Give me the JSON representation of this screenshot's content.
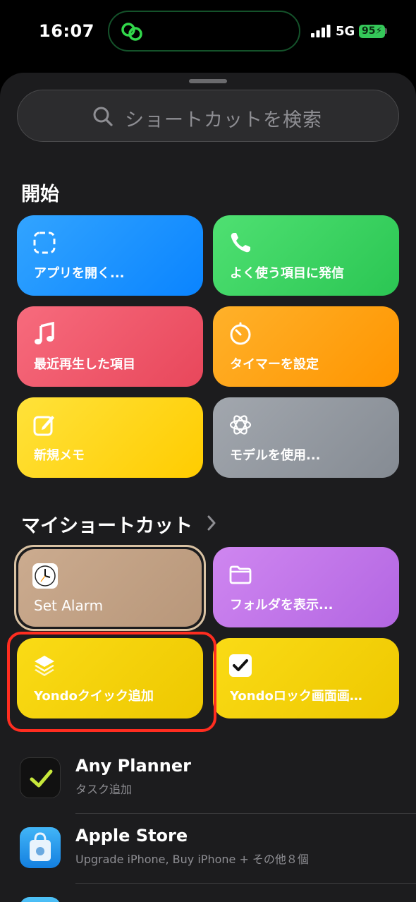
{
  "status_bar": {
    "time": "16:07",
    "network": "5G",
    "battery": "95"
  },
  "search": {
    "placeholder": "ショートカットを検索"
  },
  "sections": {
    "start_title": "開始",
    "my_shortcuts_title": "マイショートカット"
  },
  "start_tiles": [
    {
      "label": "アプリを開く...",
      "icon": "dashed-square-icon",
      "color": "#1e8fff"
    },
    {
      "label": "よく使う項目に発信",
      "icon": "phone-icon",
      "color": "#3fd160"
    },
    {
      "label": "最近再生した項目",
      "icon": "music-note-icon",
      "color": "#ef5a6c"
    },
    {
      "label": "タイマーを設定",
      "icon": "timer-icon",
      "color": "#ffa41b"
    },
    {
      "label": "新規メモ",
      "icon": "compose-icon",
      "color": "#ffd60a"
    },
    {
      "label": "モデルを使用...",
      "icon": "ai-model-icon",
      "color": "#8e949c"
    }
  ],
  "my_tiles": [
    {
      "label": "Set Alarm",
      "icon": "clock-icon",
      "color": "#c4a58a"
    },
    {
      "label": "フォルダを表示...",
      "icon": "folder-icon",
      "color": "#bf73e8"
    },
    {
      "label": "Yondoクイック追加",
      "icon": "layers-icon",
      "color": "#f4d000"
    },
    {
      "label": "Yondoロック画面画…",
      "icon": "checkbox-icon",
      "color": "#f4d000"
    }
  ],
  "apps": [
    {
      "title": "Any Planner",
      "subtitle": "タスク追加"
    },
    {
      "title": "Apple Store",
      "subtitle": "Upgrade iPhone, Buy iPhone + その他８個"
    }
  ]
}
